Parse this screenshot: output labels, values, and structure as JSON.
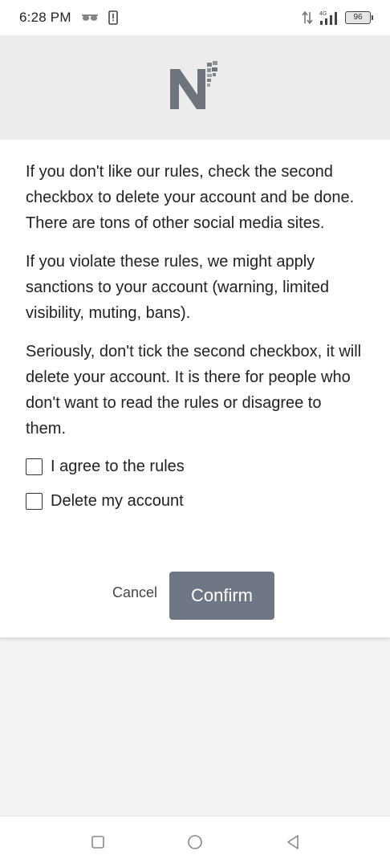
{
  "status_bar": {
    "time": "6:28 PM",
    "network": "4G",
    "battery": "96"
  },
  "dialog": {
    "paragraphs": [
      "If you don't like our rules, check the second checkbox to delete your account and be done. There are tons of other social media sites.",
      "If you violate these rules, we might apply sanctions to your account (warning, limited visibility, muting, bans).",
      "Seriously, don't tick the second checkbox, it will delete your account. It is there for people who don't want to read the rules or disagree to them."
    ],
    "checkboxes": [
      {
        "label": "I agree to the rules",
        "checked": false
      },
      {
        "label": "Delete my account",
        "checked": false
      }
    ],
    "cancel_label": "Cancel",
    "confirm_label": "Confirm"
  },
  "icons": {
    "logo": "app-logo-icon",
    "glasses": "glasses-icon",
    "phone_alert": "phone-alert-icon",
    "data_arrows": "data-transfer-icon",
    "signal": "signal-icon",
    "battery": "battery-icon",
    "nav_recents": "square-icon",
    "nav_home": "circle-icon",
    "nav_back": "triangle-back-icon"
  },
  "colors": {
    "confirm_button": "#707784",
    "header_background": "#ececec",
    "page_background": "#f2f2f2"
  }
}
